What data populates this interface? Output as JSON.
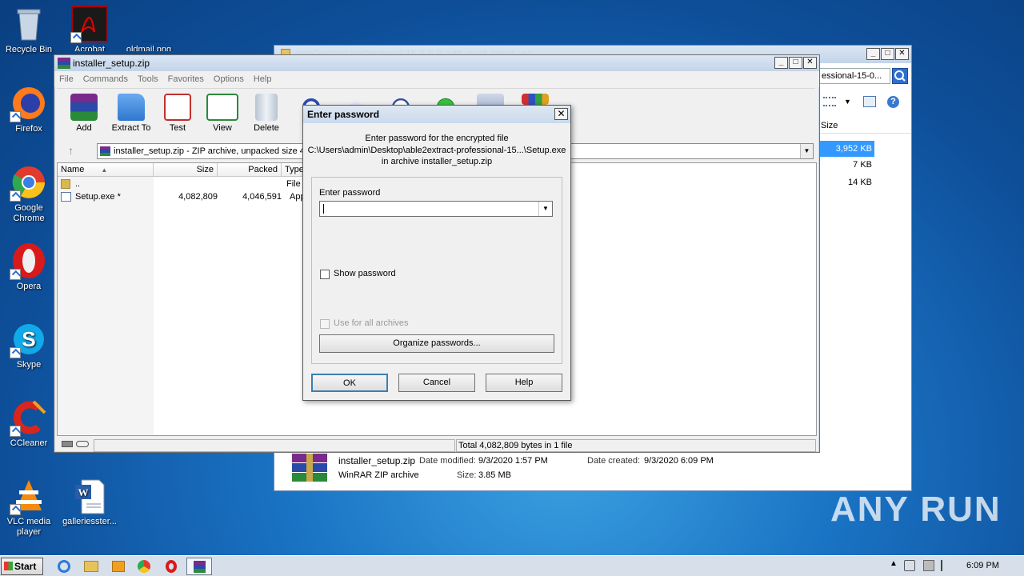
{
  "desktop": {
    "icons": [
      {
        "label": "Recycle Bin"
      },
      {
        "label": "Acrobat"
      },
      {
        "label": "oldmail.png"
      },
      {
        "label": "Firefox"
      },
      {
        "label": "Google Chrome"
      },
      {
        "label": "Opera"
      },
      {
        "label": "Skype"
      },
      {
        "label": "CCleaner"
      },
      {
        "label": "VLC media player"
      },
      {
        "label": "galleriesster..."
      }
    ],
    "watermark": "ANY RUN"
  },
  "explorer": {
    "title_fragment": "able2extract-professional-15-0-5-0-with-crack-latest-ver...",
    "search_fragment": "essional-15-0...",
    "size_header": "Size",
    "sizes": [
      "3,952 KB",
      "7 KB",
      "14 KB"
    ],
    "details": {
      "name": "installer_setup.zip",
      "modified_label": "Date modified:",
      "modified": "9/3/2020 1:57 PM",
      "created_label": "Date created:",
      "created": "9/3/2020 6:09 PM",
      "type": "WinRAR ZIP archive",
      "size_label": "Size:",
      "size": "3.85 MB"
    }
  },
  "winrar": {
    "title": "installer_setup.zip",
    "menu": [
      "File",
      "Commands",
      "Tools",
      "Favorites",
      "Options",
      "Help"
    ],
    "toolbar": [
      "Add",
      "Extract To",
      "Test",
      "View",
      "Delete"
    ],
    "address": "installer_setup.zip - ZIP archive, unpacked size 4,082,809 bytes",
    "columns": [
      "Name",
      "Size",
      "Packed",
      "Type"
    ],
    "rows": [
      {
        "name": "..",
        "size": "",
        "packed": "",
        "type": "File F"
      },
      {
        "name": "Setup.exe *",
        "size": "4,082,809",
        "packed": "4,046,591",
        "type": "Appl"
      }
    ],
    "status": "Total 4,082,809 bytes in 1 file"
  },
  "dialog": {
    "title": "Enter password",
    "info_line1": "Enter password for the encrypted file",
    "info_line2": "C:\\Users\\admin\\Desktop\\able2extract-professional-15...\\Setup.exe",
    "info_line3": "in archive installer_setup.zip",
    "field_label": "Enter password",
    "field_value": "",
    "show_password": "Show password",
    "use_for_all": "Use for all archives",
    "organize": "Organize passwords...",
    "ok": "OK",
    "cancel": "Cancel",
    "help": "Help"
  },
  "taskbar": {
    "start": "Start",
    "clock": "6:09 PM"
  },
  "colors": {
    "desktop_blue": "#1a73c4",
    "selection_blue": "#3399ff"
  }
}
